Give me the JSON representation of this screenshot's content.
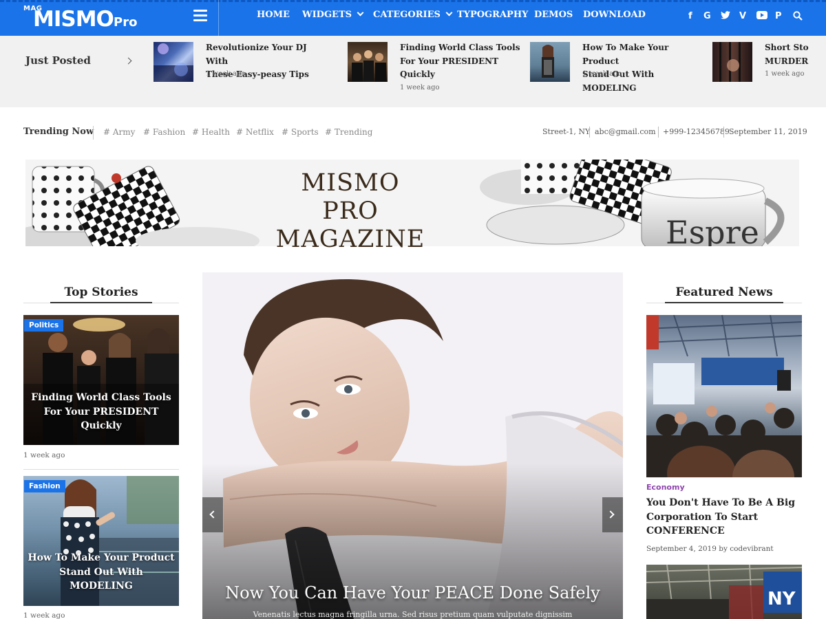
{
  "brand": {
    "mag": "MAG",
    "name": "MISMO",
    "suffix": "Pro"
  },
  "nav": {
    "items": [
      "HOME",
      "WIDGETS",
      "CATEGORIES",
      "TYPOGRAPHY",
      "DEMOS",
      "DOWNLOAD"
    ],
    "social_icons": [
      "facebook-icon",
      "google-icon",
      "twitter-icon",
      "vimeo-icon",
      "youtube-icon",
      "pinterest-icon",
      "search-icon"
    ],
    "social_glyphs": [
      "f",
      "G",
      "t",
      "V",
      "▶",
      "P",
      "⚲"
    ]
  },
  "just_posted": {
    "label": "Just Posted",
    "items": [
      {
        "title_lines": [
          "Revolutionize Your DJ With",
          "These Easy-peasy Tips"
        ],
        "time": "1 week ago"
      },
      {
        "title_lines": [
          "Finding World Class Tools",
          "For Your PRESIDENT",
          "Quickly"
        ],
        "time": "1 week ago"
      },
      {
        "title_lines": [
          "How To Make Your Product",
          "Stand Out With MODELING"
        ],
        "time": "1 week ago"
      },
      {
        "title_lines": [
          "Short Sto",
          "MURDER"
        ],
        "time": "1 week ago"
      }
    ]
  },
  "trending": {
    "label": "Trending Now",
    "tags": [
      "# Army",
      "# Fashion",
      "# Health",
      "# Netflix",
      "# Sports",
      "# Trending"
    ],
    "address": "Street-1, NY",
    "email": "abc@gmail.com",
    "phone": "+999-123456789",
    "date": "September 11, 2019"
  },
  "banner": {
    "line1": "MISMO PRO",
    "line2": "MAGAZINE"
  },
  "top_stories": {
    "heading": "Top Stories",
    "items": [
      {
        "category": "Politics",
        "title_lines": [
          "Finding World Class Tools",
          "For Your PRESIDENT",
          "Quickly"
        ],
        "time": "1 week ago"
      },
      {
        "category": "Fashion",
        "title_lines": [
          "How To Make Your Product",
          "Stand Out With",
          "MODELING"
        ],
        "time": "1 week ago"
      }
    ]
  },
  "slider": {
    "title": "Now You Can Have Your PEACE Done Safely",
    "subtitle": "Venenatis lectus magna fringilla urna. Sed risus pretium quam vulputate dignissim"
  },
  "featured": {
    "heading": "Featured News",
    "items": [
      {
        "category": "Economy",
        "title_lines": [
          "You Don't Have To Be A Big",
          "Corporation To Start",
          "CONFERENCE"
        ],
        "meta": "September 4, 2019 by codevibrant"
      }
    ]
  },
  "colors": {
    "brand_blue": "#1a73e8",
    "economy_purple": "#8e44ad"
  }
}
